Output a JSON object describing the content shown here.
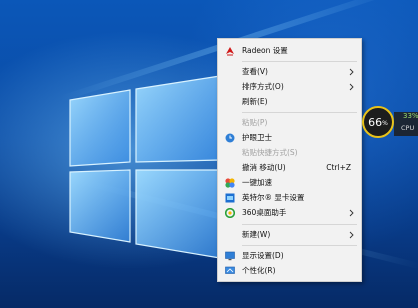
{
  "context_menu": {
    "items": [
      {
        "label": "Radeon 设置",
        "icon": "radeon-icon"
      },
      {
        "label": "查看(V)",
        "submenu": true
      },
      {
        "label": "排序方式(O)",
        "submenu": true
      },
      {
        "label": "刷新(E)"
      },
      {
        "label": "粘贴(P)",
        "disabled": true
      },
      {
        "label": "护眼卫士",
        "icon": "eye-guard-icon"
      },
      {
        "label": "粘贴快捷方式(S)",
        "disabled": true
      },
      {
        "label": "撤消 移动(U)",
        "accelerator": "Ctrl+Z"
      },
      {
        "label": "一键加速",
        "icon": "speedup-icon"
      },
      {
        "label": "英特尔® 显卡设置",
        "icon": "intel-graphics-icon"
      },
      {
        "label": "360桌面助手",
        "icon": "360-icon",
        "submenu": true
      },
      {
        "label": "新建(W)",
        "submenu": true
      },
      {
        "label": "显示设置(D)",
        "icon": "display-icon"
      },
      {
        "label": "个性化(R)",
        "icon": "personalize-icon"
      }
    ]
  },
  "widget": {
    "gauge_value": "66",
    "gauge_unit": "%",
    "cpu_percent": "33%",
    "cpu_label": "CPU"
  },
  "colors": {
    "menu_bg": "#f2f2f2",
    "gauge_ring": "#e8c21a",
    "cpu_text": "#9bdc6d"
  }
}
